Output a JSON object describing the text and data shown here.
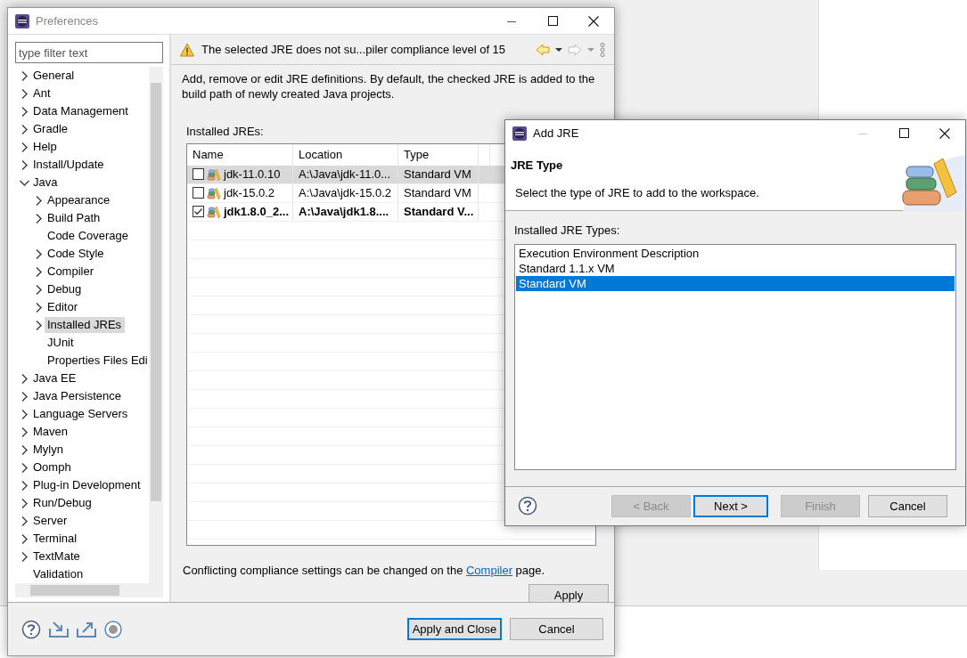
{
  "preferences": {
    "title": "Preferences",
    "filter": {
      "placeholder": "type filter text"
    },
    "tree": [
      {
        "label": "General",
        "expanded": false,
        "selected": false
      },
      {
        "label": "Ant",
        "expanded": false,
        "selected": false
      },
      {
        "label": "Data Management",
        "expanded": false,
        "selected": false
      },
      {
        "label": "Gradle",
        "expanded": false,
        "selected": false
      },
      {
        "label": "Help",
        "expanded": false,
        "selected": false
      },
      {
        "label": "Install/Update",
        "expanded": false,
        "selected": false
      },
      {
        "label": "Java",
        "expanded": true,
        "selected": false,
        "children": [
          {
            "label": "Appearance",
            "expanded": false,
            "selected": false
          },
          {
            "label": "Build Path",
            "expanded": false,
            "selected": false
          },
          {
            "label": "Code Coverage",
            "selected": false
          },
          {
            "label": "Code Style",
            "expanded": false,
            "selected": false
          },
          {
            "label": "Compiler",
            "expanded": false,
            "selected": false
          },
          {
            "label": "Debug",
            "expanded": false,
            "selected": false
          },
          {
            "label": "Editor",
            "expanded": false,
            "selected": false
          },
          {
            "label": "Installed JREs",
            "expanded": false,
            "selected": true
          },
          {
            "label": "JUnit",
            "selected": false
          },
          {
            "label": "Properties Files Edi",
            "selected": false
          }
        ]
      },
      {
        "label": "Java EE",
        "expanded": false,
        "selected": false
      },
      {
        "label": "Java Persistence",
        "expanded": false,
        "selected": false
      },
      {
        "label": "Language Servers",
        "expanded": false,
        "selected": false
      },
      {
        "label": "Maven",
        "expanded": false,
        "selected": false
      },
      {
        "label": "Mylyn",
        "expanded": false,
        "selected": false
      },
      {
        "label": "Oomph",
        "expanded": false,
        "selected": false
      },
      {
        "label": "Plug-in Development",
        "expanded": false,
        "selected": false
      },
      {
        "label": "Run/Debug",
        "expanded": false,
        "selected": false
      },
      {
        "label": "Server",
        "expanded": false,
        "selected": false
      },
      {
        "label": "Terminal",
        "expanded": false,
        "selected": false
      },
      {
        "label": "TextMate",
        "expanded": false,
        "selected": false
      },
      {
        "label": "Validation",
        "selected": false
      }
    ],
    "message": "The selected JRE does not su...piler compliance level of 15",
    "description": "Add, remove or edit JRE definitions. By default, the checked JRE is added to the build path of newly created Java projects.",
    "installed_label": "Installed JREs:",
    "table": {
      "columns": [
        "Name",
        "Location",
        "Type"
      ],
      "rows": [
        {
          "name": "jdk-11.0.10",
          "location": "A:\\Java\\jdk-11.0...",
          "type": "Standard VM",
          "checked": false,
          "selected": true
        },
        {
          "name": "jdk-15.0.2",
          "location": "A:\\Java\\jdk-15.0.2",
          "type": "Standard VM",
          "checked": false,
          "selected": false
        },
        {
          "name": "jdk1.8.0_2...",
          "location": "A:\\Java\\jdk1.8....",
          "type": "Standard V...",
          "checked": true,
          "selected": false
        }
      ]
    },
    "note": {
      "before": "Conflicting compliance settings can be changed on the",
      "link": "Compiler",
      "after": "page."
    },
    "apply": "Apply",
    "buttons": [
      {
        "label": "Apply and Close",
        "default": true
      },
      {
        "label": "Cancel",
        "default": false
      }
    ]
  },
  "add_jre": {
    "title": "Add JRE",
    "heading": "JRE Type",
    "subtitle": "Select the type of JRE to add to the workspace.",
    "list_label": "Installed JRE Types:",
    "types": [
      {
        "label": "Execution Environment Description",
        "selected": false
      },
      {
        "label": "Standard 1.1.x VM",
        "selected": false
      },
      {
        "label": "Standard VM",
        "selected": true
      }
    ],
    "buttons": [
      {
        "label": "< Back",
        "disabled": true,
        "default": false
      },
      {
        "label": "Next >",
        "disabled": false,
        "default": true
      },
      {
        "label": "Finish",
        "disabled": true,
        "default": false
      },
      {
        "label": "Cancel",
        "disabled": false,
        "default": false
      }
    ]
  }
}
